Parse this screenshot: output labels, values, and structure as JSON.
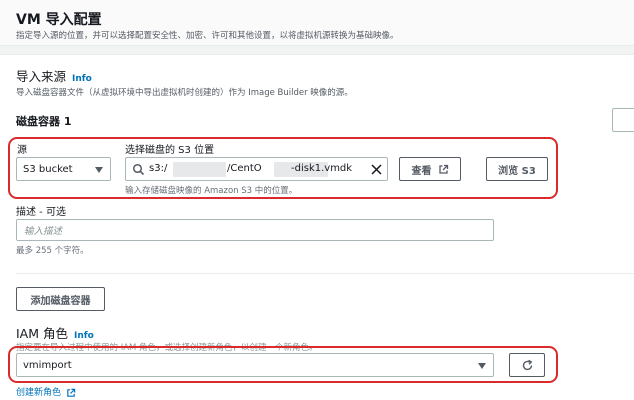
{
  "header": {
    "title": "VM 导入配置",
    "description": "指定导入源的位置，并可以选择配置安全性、加密、许可和其他设置，以将虚拟机源转换为基础映像。"
  },
  "import_source": {
    "title": "导入来源",
    "info_label": "Info",
    "description": "导入磁盘容器文件（从虚拟环境中导出虚拟机时创建的）作为 Image Builder 映像的源。"
  },
  "disk_container": {
    "title": "磁盘容器 1",
    "source_label": "源",
    "source_value": "S3 bucket",
    "s3_label": "选择磁盘的 S3 位置",
    "s3_value_parts": [
      "s3:/",
      "/CentO",
      "-disk1.vmdk"
    ],
    "s3_hint": "输入存储磁盘映像的 Amazon S3 中的位置。",
    "view_button": "查看",
    "browse_button": "浏览 S3",
    "desc_label": "描述 - 可选",
    "desc_placeholder": "输入描述",
    "desc_hint": "最多 255 个字符。",
    "add_button": "添加磁盘容器"
  },
  "iam": {
    "title": "IAM 角色",
    "info_label": "Info",
    "description": "指定要在导入过程中使用的 IAM 角色，或选择创建新角色，以创建一个新角色。",
    "role_value": "vmimport",
    "create_link": "创建新角色"
  },
  "colors": {
    "highlight": "#d92b2b",
    "link": "#0073bb"
  }
}
